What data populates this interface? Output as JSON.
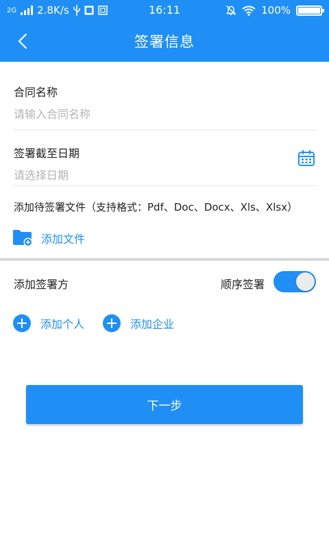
{
  "status_bar": {
    "network": "2G",
    "speed": "2.8K/s",
    "time": "16:11",
    "battery": "100%"
  },
  "header": {
    "title": "签署信息",
    "back_icon": "chevron-left-icon"
  },
  "form": {
    "contract_name": {
      "label": "合同名称",
      "placeholder": "请输入合同名称",
      "value": ""
    },
    "deadline": {
      "label": "签署截至日期",
      "placeholder": "请选择日期",
      "value": "",
      "icon": "calendar-icon"
    },
    "files": {
      "label": "添加待签署文件（支持格式：Pdf、Doc、Docx、Xls、Xlsx）",
      "add_label": "添加文件",
      "icon": "folder-add-icon"
    }
  },
  "signers": {
    "label": "添加签署方",
    "sequential_label": "顺序签署",
    "sequential_on": true,
    "add_person": "添加个人",
    "add_company": "添加企业"
  },
  "next_button": "下一步",
  "colors": {
    "primary": "#1f8ff5",
    "divider": "#e6e6e6",
    "placeholder": "#b4b4b4"
  }
}
